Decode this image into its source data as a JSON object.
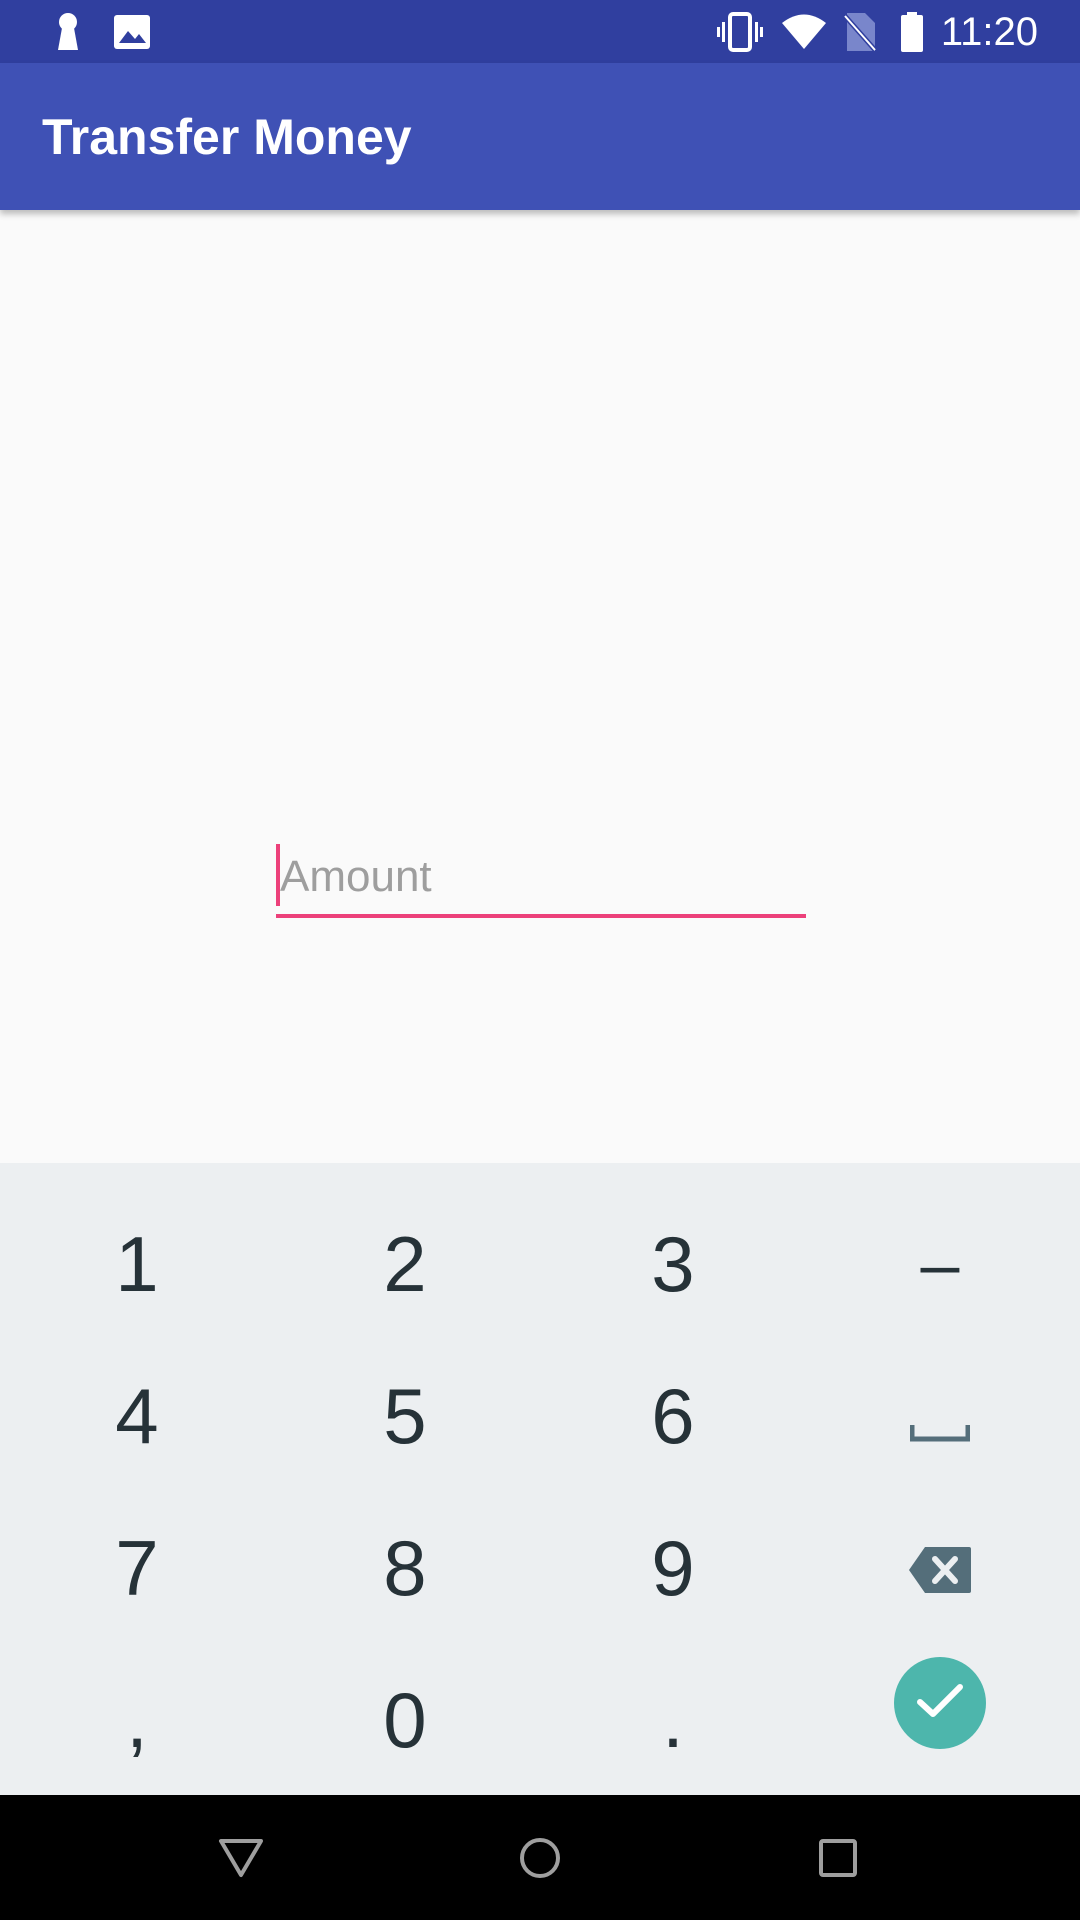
{
  "status_bar": {
    "time": "11:20",
    "icons": [
      "keyhole-icon",
      "image-icon",
      "vibrate-icon",
      "wifi-icon",
      "no-sim-icon",
      "battery-icon"
    ]
  },
  "app_bar": {
    "title": "Transfer Money"
  },
  "form": {
    "amount_placeholder": "Amount",
    "amount_value": ""
  },
  "keyboard": {
    "rows": [
      [
        "1",
        "2",
        "3",
        "–"
      ],
      [
        "4",
        "5",
        "6",
        "space"
      ],
      [
        "7",
        "8",
        "9",
        "backspace"
      ],
      [
        ",",
        "0",
        ".",
        "done"
      ]
    ],
    "k1": "1",
    "k2": "2",
    "k3": "3",
    "k_minus": "–",
    "k4": "4",
    "k5": "5",
    "k6": "6",
    "k7": "7",
    "k8": "8",
    "k9": "9",
    "k_comma": ",",
    "k0": "0",
    "k_period": "."
  },
  "nav_bar": {
    "buttons": [
      "back-icon",
      "home-icon",
      "recents-icon"
    ]
  },
  "colors": {
    "status_bar": "#303f9f",
    "app_bar": "#3f51b5",
    "accent": "#ec407a",
    "done_key": "#4db6ac",
    "keyboard_bg": "#eceff1"
  }
}
